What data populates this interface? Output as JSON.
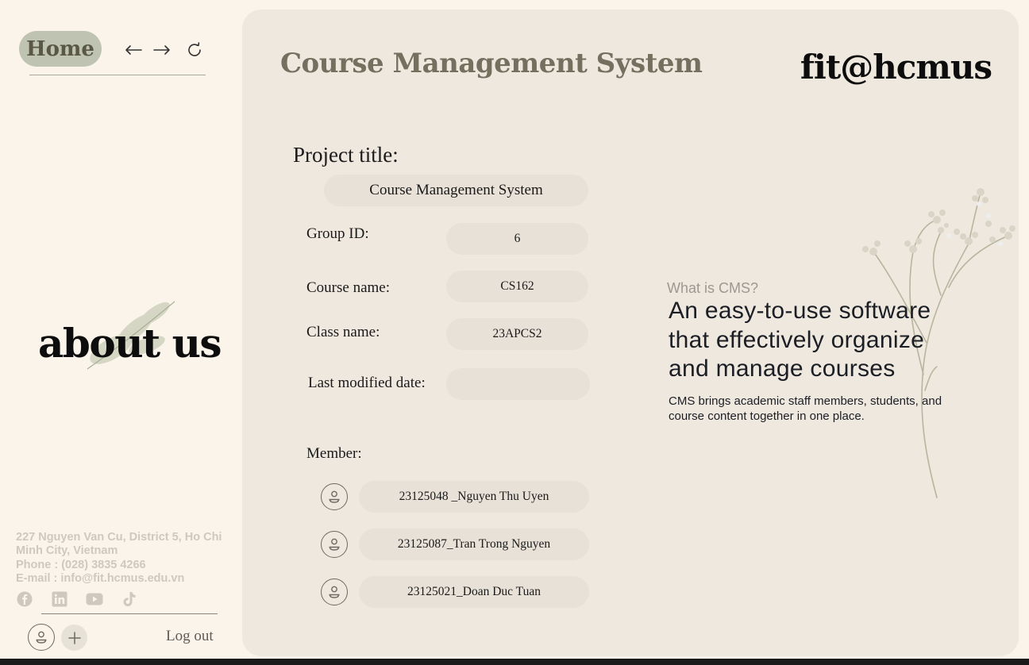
{
  "sidebar": {
    "home_label": "Home",
    "about_label": "about us",
    "contact": {
      "address": "227 Nguyen Van Cu, District 5, Ho Chi Minh City, Vietnam",
      "phone": "Phone : (028) 3835 4266",
      "email": "E-mail : info@fit.hcmus.edu.vn"
    },
    "socials": [
      "facebook-icon",
      "linkedin-icon",
      "youtube-icon",
      "tiktok-icon"
    ],
    "logout_label": "Log out"
  },
  "header": {
    "title": "Course Management System",
    "brand": "fit@hcmus"
  },
  "form": {
    "project_title_label": "Project title:",
    "project_title_value": "Course Management System",
    "group_id_label": "Group ID:",
    "group_id_value": "6",
    "course_name_label": "Course name:",
    "course_name_value": "CS162",
    "class_name_label": "Class name:",
    "class_name_value": "23APCS2",
    "last_modified_label": "Last modified date:",
    "last_modified_value": "",
    "member_label": "Member:",
    "members": [
      "23125048 _Nguyen Thu Uyen",
      "23125087_Tran Trong Nguyen",
      "23125021_Doan Duc Tuan"
    ]
  },
  "info": {
    "question": "What is CMS?",
    "headline": "An easy-to-use software that effectively organize and manage courses",
    "description": "CMS brings academic staff members, students, and course content together in one place."
  },
  "colors": {
    "background": "#fbf4ea",
    "panel": "#efe8df",
    "home_pill": "#bfc3b1",
    "field": "#e8e1d7"
  }
}
